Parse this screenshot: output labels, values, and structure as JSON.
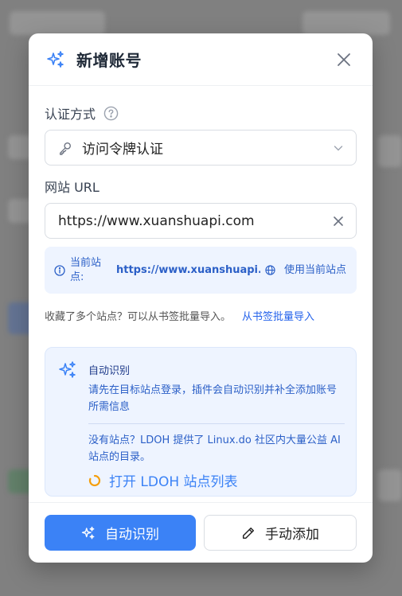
{
  "modal": {
    "title": "新增账号",
    "auth": {
      "label": "认证方式",
      "selected": "访问令牌认证"
    },
    "url": {
      "label": "网站 URL",
      "value": "https://www.xuanshuapi.com"
    },
    "current_site": {
      "label": "当前站点:",
      "url": "https://www.xuanshuapi....",
      "use_label": "使用当前站点"
    },
    "bookmark": {
      "text": "收藏了多个站点？可以从书签批量导入。",
      "link": "从书签批量导入"
    },
    "auto_detect": {
      "title": "自动识别",
      "description": "请先在目标站点登录，插件会自动识别并补全添加账号所需信息",
      "note": "没有站点？LDOH 提供了 Linux.do 社区内大量公益 AI 站点的目录。",
      "link": "打开 LDOH 站点列表"
    },
    "footer": {
      "auto_button": "自动识别",
      "manual_button": "手动添加"
    }
  },
  "colors": {
    "accent": "#3b82f6",
    "info_bg": "#eef4ff",
    "info_text": "#2b5fc7",
    "ldoh_icon": "#f59e0b"
  }
}
